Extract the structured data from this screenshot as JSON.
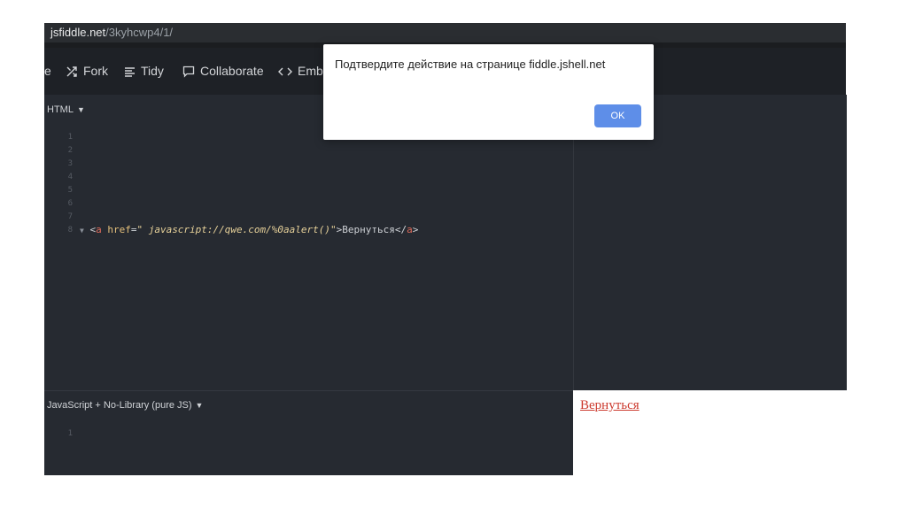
{
  "browser": {
    "url_host": "jsfiddle.net",
    "url_path": "/3kyhcwp4/1/"
  },
  "toolbar": {
    "partial_label": "e",
    "fork_label": "Fork",
    "tidy_label": "Tidy",
    "collaborate_label": "Collaborate",
    "embed_label": "Emb"
  },
  "html_panel": {
    "label": "HTML",
    "line_numbers": [
      "1",
      "2",
      "3",
      "4",
      "5",
      "6",
      "7",
      "8"
    ],
    "code": {
      "open_bracket": "<",
      "tag": "a",
      "attr": "href",
      "eq": "=",
      "value": "\" javascript://qwe.com/%0aalert()\"",
      "close_bracket": ">",
      "text": "Вернуться",
      "end_open": "</",
      "end_tag": "a",
      "end_close": ">"
    }
  },
  "js_panel": {
    "label": "JavaScript + No-Library (pure JS)",
    "line_numbers": [
      "1"
    ]
  },
  "result": {
    "link_text": "Вернуться"
  },
  "dialog": {
    "message": "Подтвердите действие на странице fiddle.jshell.net",
    "ok_label": "OK"
  },
  "colors": {
    "accent": "#5e8ee8",
    "editor_bg": "#262a31",
    "link": "#cc3a2e"
  }
}
